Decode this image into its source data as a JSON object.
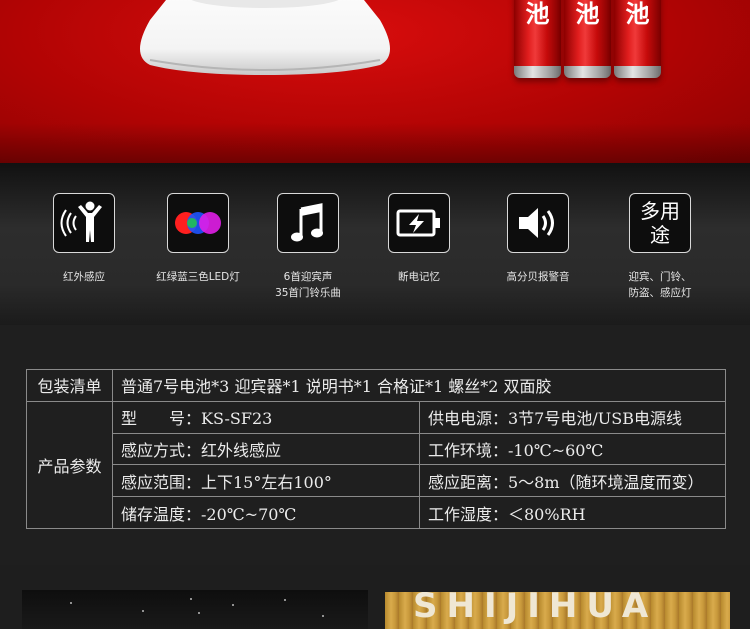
{
  "banner": {
    "battery_char": "池",
    "colors": {
      "red": "#b20404",
      "dome": "#f2f2f2"
    }
  },
  "features": [
    {
      "icon": "motion-sensor-icon",
      "label": "红外感应"
    },
    {
      "icon": "rgb-led-icon",
      "label": "红绿蓝三色LED灯"
    },
    {
      "icon": "music-note-icon",
      "label_line1": "6首迎宾声",
      "label_line2": "35首门铃乐曲"
    },
    {
      "icon": "battery-charging-icon",
      "label": "断电记忆"
    },
    {
      "icon": "speaker-icon",
      "label": "高分贝报警音"
    },
    {
      "icon": "multi-use-icon",
      "icon_text_1": "多用",
      "icon_text_2": "途",
      "label_line1": "迎宾、门铃、",
      "label_line2": "防盗、感应灯"
    }
  ],
  "specs": {
    "package_label": "包装清单",
    "package_value": "普通7号电池*3 迎宾器*1 说明书*1 合格证*1 螺丝*2 双面胶",
    "params_label": "产品参数",
    "rows": [
      [
        "型　　号：KS-SF23",
        "供电电源：3节7号电池/USB电源线"
      ],
      [
        "感应方式：红外线感应",
        "工作环境：-10℃~60℃"
      ],
      [
        "感应范围：上下15°左右100°",
        "感应距离：5～8m（随环境温度而变）"
      ],
      [
        "储存温度：-20℃~70℃",
        "工作湿度：＜80%RH"
      ]
    ]
  },
  "thumbs": {
    "right_text": "SHIJIHUA"
  }
}
